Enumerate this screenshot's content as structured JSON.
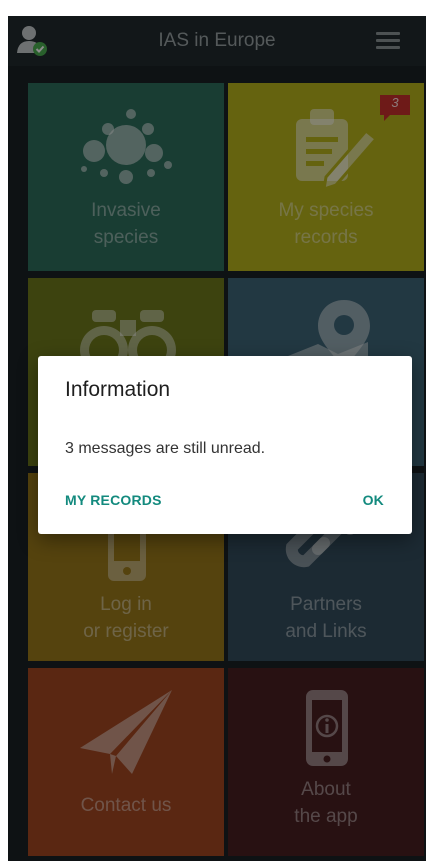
{
  "app": {
    "title": "IAS in Europe",
    "icons": {
      "user": "user-verified-icon",
      "menu": "hamburger-menu-icon"
    }
  },
  "tiles": [
    {
      "label": "Invasive\nspecies",
      "color": "#2f6f5e",
      "icon": "species-dots-icon"
    },
    {
      "label": "My species\nrecords",
      "color": "#b9b41c",
      "icon": "clipboard-pencil-icon",
      "badge": "3"
    },
    {
      "label": "",
      "color": "#6f7a1c",
      "icon": "binoculars-icon"
    },
    {
      "label": "",
      "color": "#3f6679",
      "icon": "map-pin-icon"
    },
    {
      "label": "Log in\nor register",
      "color": "#9c7a1b",
      "icon": "phone-login-icon"
    },
    {
      "label": "Partners\nand Links",
      "color": "#344d5d",
      "icon": "chain-link-icon"
    },
    {
      "label": "Contact us",
      "color": "#a44722",
      "icon": "paper-plane-icon"
    },
    {
      "label": "About\nthe app",
      "color": "#4a1f22",
      "icon": "phone-info-icon"
    }
  ],
  "dialog": {
    "title": "Information",
    "message": "3 messages are still unread.",
    "button_left": "MY RECORDS",
    "button_right": "OK"
  },
  "colors": {
    "topbar": "#222a2e",
    "accent": "#138a7e",
    "badge": "#c9302c"
  }
}
